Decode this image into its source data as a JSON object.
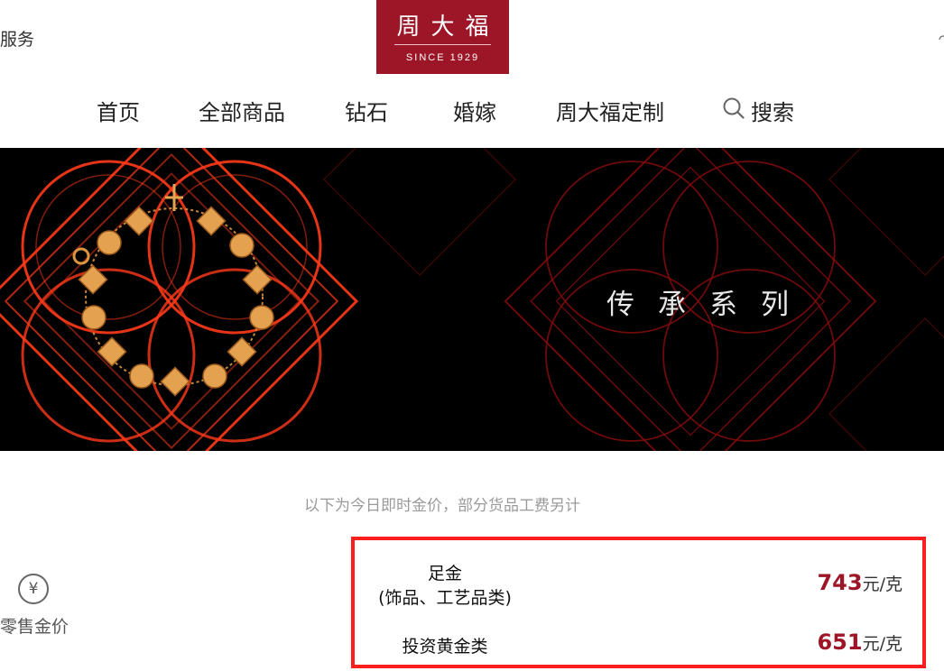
{
  "header": {
    "service_label": "服务",
    "logo": {
      "chinese": "周大福",
      "english": "SINCE 1929"
    }
  },
  "nav": {
    "items": [
      "首页",
      "全部商品",
      "钻石",
      "婚嫁",
      "周大福定制"
    ],
    "search_label": "搜索"
  },
  "banner": {
    "title": "传承系列"
  },
  "notice": "以下为今日即时金价，部分货品工费另计",
  "gold_price": {
    "section_label": "零售金价",
    "section_icon": "yuan-icon",
    "rows": [
      {
        "name": "足金",
        "subname": "(饰品、工艺品类)",
        "price": "743",
        "unit": "元/克"
      },
      {
        "name": "投资黄金类",
        "price": "651",
        "unit": "元/克"
      }
    ]
  },
  "colors": {
    "brand_red": "#9d1628",
    "highlight_border": "#ff1e1e",
    "banner_bg": "#000000"
  }
}
